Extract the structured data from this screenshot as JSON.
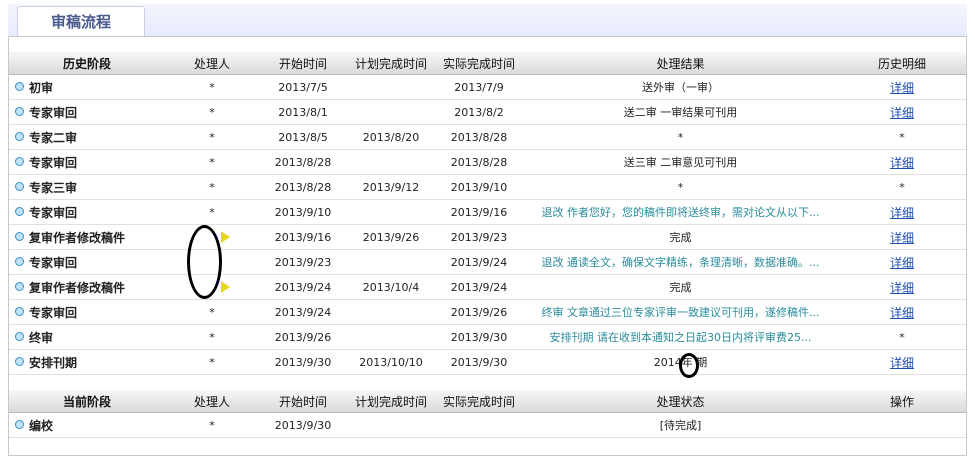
{
  "tab": {
    "title": "审稿流程"
  },
  "history": {
    "headers": [
      "历史阶段",
      "处理人",
      "开始时间",
      "计划完成时间",
      "实际完成时间",
      "处理结果",
      "历史明细"
    ],
    "rows": [
      {
        "stage": "初审",
        "handler": "*",
        "start": "2013/7/5",
        "plan": "",
        "actual": "2013/7/9",
        "result": "送外审（一审）",
        "detail": "详细"
      },
      {
        "stage": "专家审回",
        "handler": "*",
        "start": "2013/8/1",
        "plan": "",
        "actual": "2013/8/2",
        "result": "送二审 一审结果可刊用",
        "detail": "详细"
      },
      {
        "stage": "专家二审",
        "handler": "*",
        "start": "2013/8/5",
        "plan": "2013/8/20",
        "actual": "2013/8/28",
        "result": "*",
        "detail": "*"
      },
      {
        "stage": "专家审回",
        "handler": "*",
        "start": "2013/8/28",
        "plan": "",
        "actual": "2013/8/28",
        "result": "送三审 二审意见可刊用",
        "detail": "详细"
      },
      {
        "stage": "专家三审",
        "handler": "*",
        "start": "2013/8/28",
        "plan": "2013/9/12",
        "actual": "2013/9/10",
        "result": "*",
        "detail": "*"
      },
      {
        "stage": "专家审回",
        "handler": "*",
        "start": "2013/9/10",
        "plan": "",
        "actual": "2013/9/16",
        "result": "退改 作者您好，您的稿件即将送终审，需对论文从以下...",
        "detail": "详细"
      },
      {
        "stage": "复审作者修改稿件",
        "handler": "",
        "start": "2013/9/16",
        "plan": "2013/9/26",
        "actual": "2013/9/23",
        "result": "完成",
        "detail": "详细"
      },
      {
        "stage": "专家审回",
        "handler": "",
        "start": "2013/9/23",
        "plan": "",
        "actual": "2013/9/24",
        "result": "退改 通读全文，确保文字精练，条理清晰，数据准确。...",
        "detail": "详细"
      },
      {
        "stage": "复审作者修改稿件",
        "handler": "",
        "start": "2013/9/24",
        "plan": "2013/10/4",
        "actual": "2013/9/24",
        "result": "完成",
        "detail": "详细"
      },
      {
        "stage": "专家审回",
        "handler": "*",
        "start": "2013/9/24",
        "plan": "",
        "actual": "2013/9/26",
        "result": "终审 文章通过三位专家评审一致建议可刊用，遂修稿件...",
        "detail": "详细"
      },
      {
        "stage": "终审",
        "handler": "*",
        "start": "2013/9/26",
        "plan": "",
        "actual": "2013/9/30",
        "result": "安排刊期 请在收到本通知之日起30日内将评审费25...",
        "detail": "*"
      },
      {
        "stage": "安排刊期",
        "handler": "*",
        "start": "2013/9/30",
        "plan": "2013/10/10",
        "actual": "2013/9/30",
        "result": "2014年  期",
        "detail": "详细"
      }
    ]
  },
  "current": {
    "headers": [
      "当前阶段",
      "处理人",
      "开始时间",
      "计划完成时间",
      "实际完成时间",
      "处理状态",
      "操作"
    ],
    "rows": [
      {
        "stage": "编校",
        "handler": "*",
        "start": "2013/9/30",
        "plan": "",
        "actual": "",
        "result": "[待完成]",
        "detail": ""
      }
    ]
  },
  "colors": {
    "teal_result": "#2a8c9c",
    "link": "#1f4fb0",
    "tab_text": "#4a5a8c"
  }
}
